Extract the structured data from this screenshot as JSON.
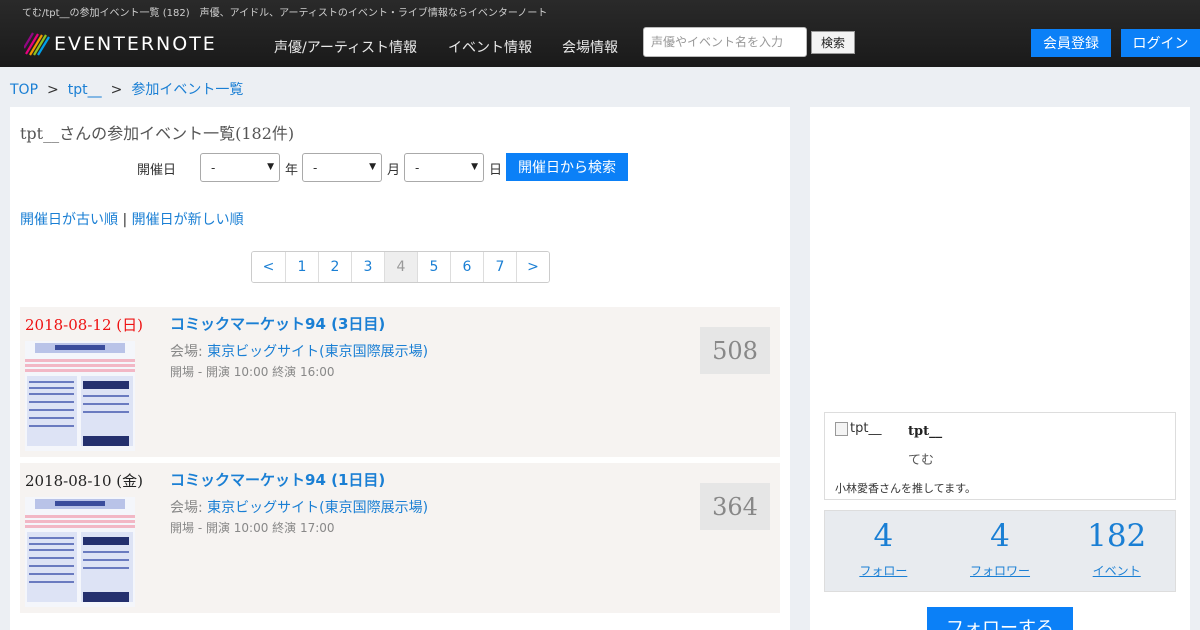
{
  "header": {
    "tagline": "てむ/tpt__の参加イベント一覧 (182)　声優、アイドル、アーティストのイベント・ライブ情報ならイベンターノート",
    "logo_text": "EVENTERNOTE",
    "nav": [
      "声優/アーティスト情報",
      "イベント情報",
      "会場情報"
    ],
    "search_placeholder": "声優やイベント名を入力",
    "search_button": "検索",
    "register_button": "会員登録",
    "login_button": "ログイン",
    "accent_color": "#0b80f7"
  },
  "breadcrumb": {
    "items": [
      "TOP",
      "tpt__",
      "参加イベント一覧"
    ],
    "separator": ">"
  },
  "main": {
    "title": "tpt__さんの参加イベント一覧(182件)",
    "date_filter": {
      "label": "開催日",
      "year_value": "-",
      "year_unit": "年",
      "month_value": "-",
      "month_unit": "月",
      "day_value": "-",
      "day_unit": "日",
      "search_button": "開催日から検索"
    },
    "sort": {
      "oldest": "開催日が古い順",
      "divider": "|",
      "newest": "開催日が新しい順"
    },
    "pagination": {
      "prev": "<",
      "pages": [
        "1",
        "2",
        "3",
        "4",
        "5",
        "6",
        "7"
      ],
      "current": "4",
      "next": ">"
    },
    "events": [
      {
        "date": "2018-08-12 (日)",
        "title": "コミックマーケット94 (3日目)",
        "venue_label": "会場:",
        "venue": "東京ビッグサイト(東京国際展示場)",
        "time": "開場 - 開演 10:00 終演 16:00",
        "count": "508"
      },
      {
        "date": "2018-08-10 (金)",
        "title": "コミックマーケット94 (1日目)",
        "venue_label": "会場:",
        "venue": "東京ビッグサイト(東京国際展示場)",
        "time": "開場 - 開演 10:00 終演 17:00",
        "count": "364"
      }
    ]
  },
  "sidebar": {
    "profile": {
      "avatar_alt": "tpt__",
      "name": "tpt__",
      "nickname": "てむ",
      "bio": "小林愛香さんを推してます。"
    },
    "stats": [
      {
        "value": "4",
        "label": "フォロー"
      },
      {
        "value": "4",
        "label": "フォロワー"
      },
      {
        "value": "182",
        "label": "イベント"
      }
    ],
    "follow_button": "フォローする"
  }
}
